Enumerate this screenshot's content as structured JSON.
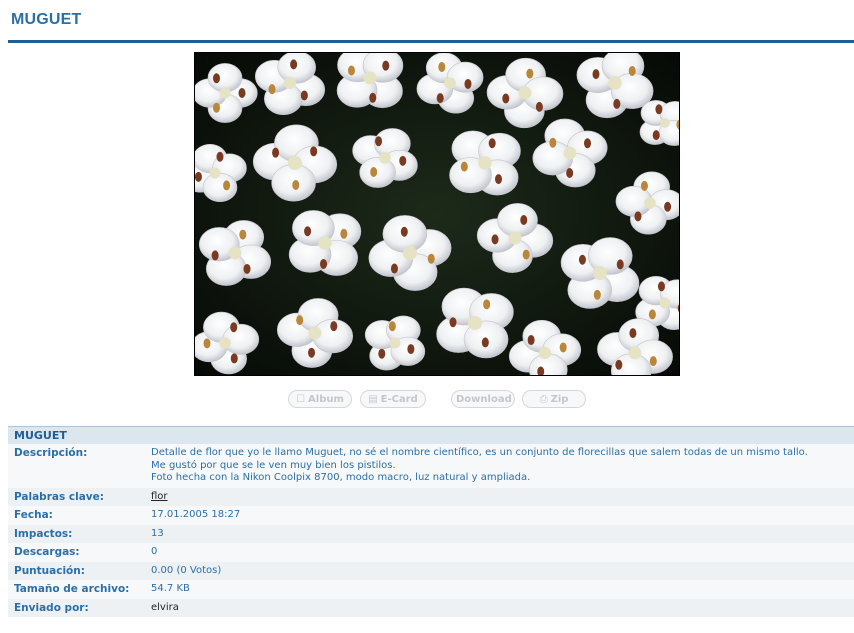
{
  "page": {
    "title": "MUGUET"
  },
  "actions": [
    {
      "label": "Album",
      "icon": "☐"
    },
    {
      "label": "E-Card",
      "icon": "▤"
    },
    {
      "label": "Download",
      "icon": ""
    },
    {
      "label": "Zip",
      "icon": "⎙"
    }
  ],
  "info": {
    "heading": "MUGUET",
    "description_label": "Descripción:",
    "description_lines": [
      "Detalle de flor que yo le llamo Muguet, no sé el nombre científico, es un conjunto de florecillas que salem todas de un mismo tallo.",
      "Me gustó por que se le ven muy bien los pistilos.",
      "Foto hecha con la Nikon Coolpix 8700, modo macro, luz natural y ampliada."
    ],
    "keywords_label": "Palabras clave:",
    "keywords_value": "flor",
    "date_label": "Fecha:",
    "date_value": "17.01.2005 18:27",
    "hits_label": "Impactos:",
    "hits_value": "13",
    "downloads_label": "Descargas:",
    "downloads_value": "0",
    "rating_label": "Puntuación:",
    "rating_value": "0.00 (0 Votos)",
    "filesize_label": "Tamaño de archivo:",
    "filesize_value": "54.7 KB",
    "sender_label": "Enviado por:",
    "sender_value": "elvira"
  }
}
